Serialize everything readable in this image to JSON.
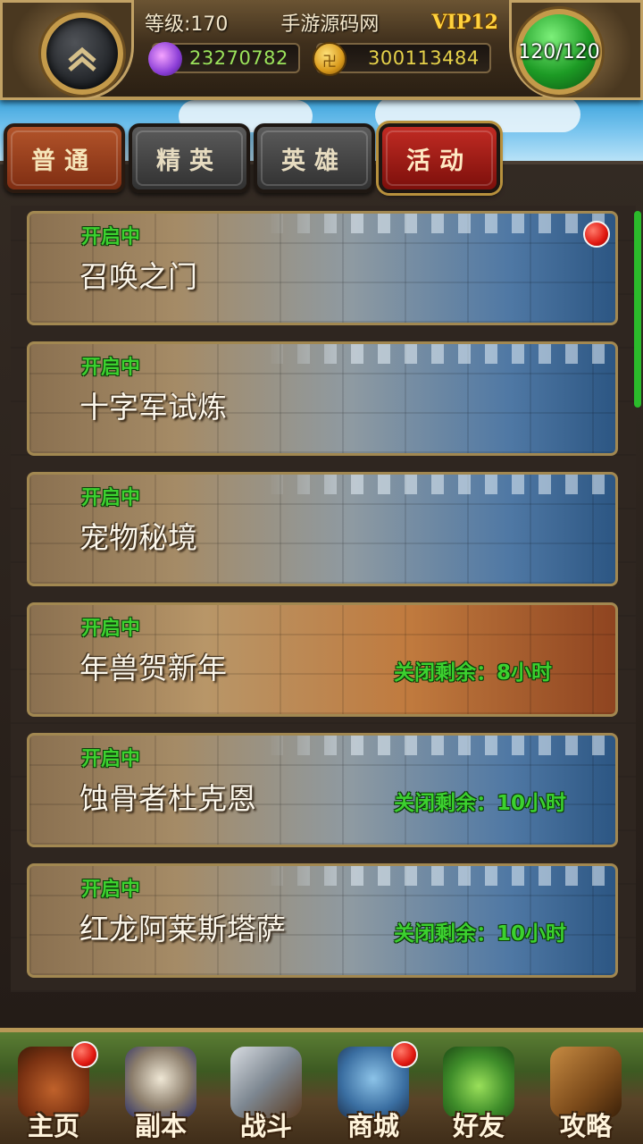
{
  "header": {
    "level_text": "等级:170",
    "site_title": "手游源码网",
    "vip_text": "VIP12",
    "gems": "23270782",
    "gold": "300113484",
    "stamina": "120/120"
  },
  "tabs": [
    {
      "label": "普通",
      "color": "#9a4120"
    },
    {
      "label": "精英",
      "color": "#444444"
    },
    {
      "label": "英雄",
      "color": "#444444"
    },
    {
      "label": "活动",
      "color": "#a01a14",
      "selected": true
    }
  ],
  "activities": [
    {
      "status": "开启中",
      "name": "召唤之门",
      "timer": "",
      "has_alert": true,
      "theme": "ice"
    },
    {
      "status": "开启中",
      "name": "十字军试炼",
      "timer": "",
      "has_alert": false,
      "theme": "ice"
    },
    {
      "status": "开启中",
      "name": "宠物秘境",
      "timer": "",
      "has_alert": false,
      "theme": "ice"
    },
    {
      "status": "开启中",
      "name": "年兽贺新年",
      "timer": "关闭剩余：8小时",
      "has_alert": false,
      "theme": "fire"
    },
    {
      "status": "开启中",
      "name": "蚀骨者杜克恩",
      "timer": "关闭剩余：10小时",
      "has_alert": false,
      "theme": "ice"
    },
    {
      "status": "开启中",
      "name": "红龙阿莱斯塔萨",
      "timer": "关闭剩余：10小时",
      "has_alert": false,
      "theme": "ice"
    }
  ],
  "nav": [
    {
      "label": "主页",
      "icon": "home-icon",
      "badge": true
    },
    {
      "label": "副本",
      "icon": "dungeon-icon",
      "badge": false
    },
    {
      "label": "战斗",
      "icon": "battle-icon",
      "badge": false
    },
    {
      "label": "商城",
      "icon": "shop-icon",
      "badge": true
    },
    {
      "label": "好友",
      "icon": "friends-icon",
      "badge": false
    },
    {
      "label": "攻略",
      "icon": "guide-icon",
      "badge": false
    }
  ],
  "colors": {
    "status_green": "#3cd12f",
    "alert_red": "#e01810",
    "gold_text": "#e6d24a",
    "gem_text": "#9be35b"
  }
}
